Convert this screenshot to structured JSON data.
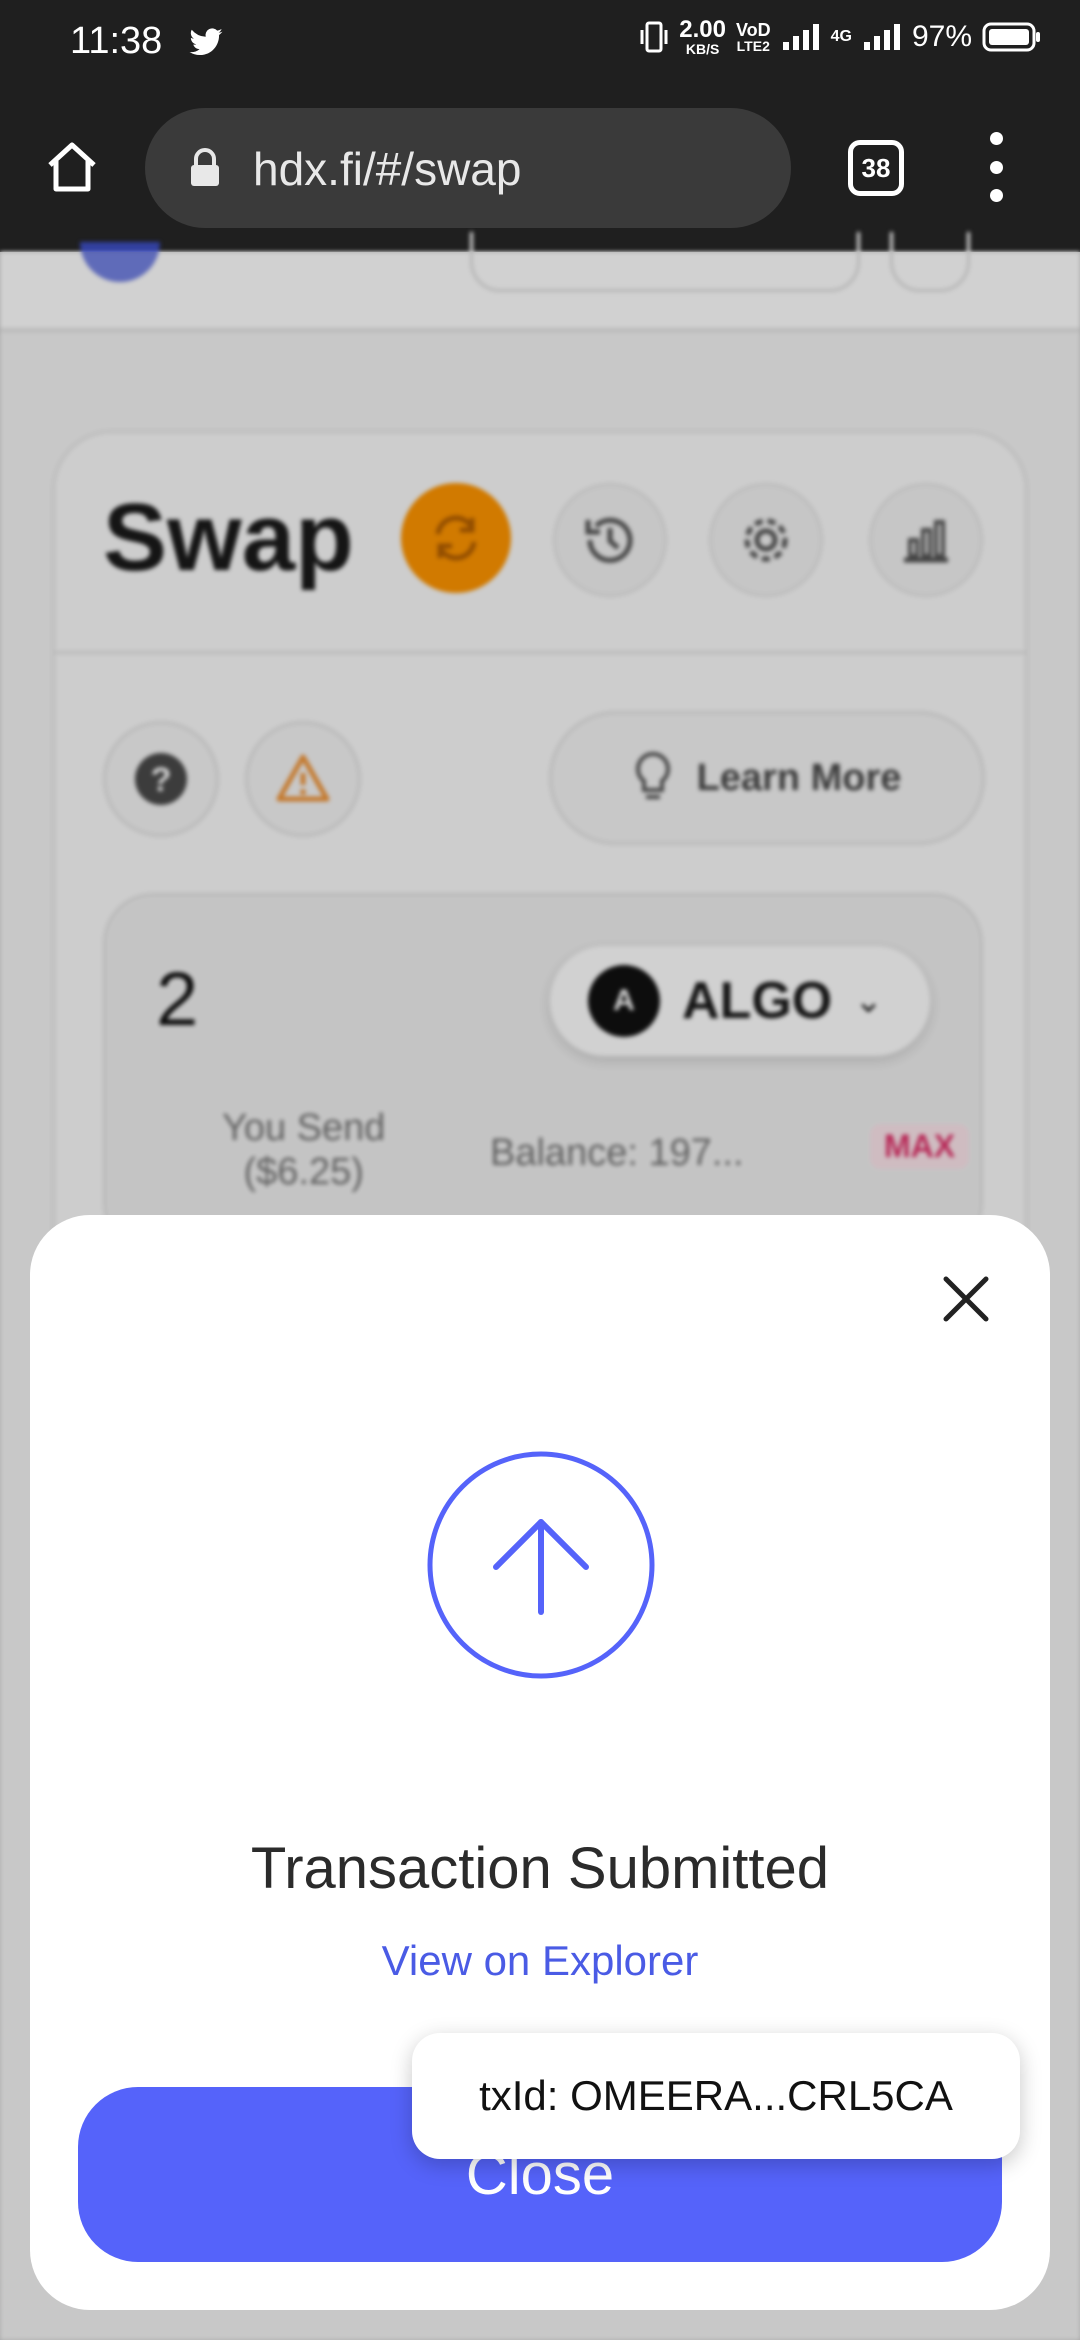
{
  "status_bar": {
    "time": "11:38",
    "net_speed_top": "2.00",
    "net_speed_unit": "KB/S",
    "volte_top": "VoD",
    "volte_bottom": "LTE2",
    "network": "4G",
    "battery": "97%"
  },
  "browser": {
    "url": "hdx.fi/#/swap",
    "tab_count": "38"
  },
  "swap_card": {
    "title": "Swap",
    "learn_more": "Learn More",
    "send_amount": "2",
    "token": "ALGO",
    "you_send": "You Send",
    "you_send_usd": "($6.25)",
    "balance": "Balance: 197...",
    "max": "MAX"
  },
  "modal": {
    "title": "Transaction Submitted",
    "explorer_link": "View on Explorer",
    "close_label": "Close"
  },
  "toast": {
    "text": "txId: OMEERA...CRL5CA"
  },
  "colors": {
    "accent": "#5563FA",
    "orange": "#FF9500",
    "max_pink": "#E0336B"
  }
}
